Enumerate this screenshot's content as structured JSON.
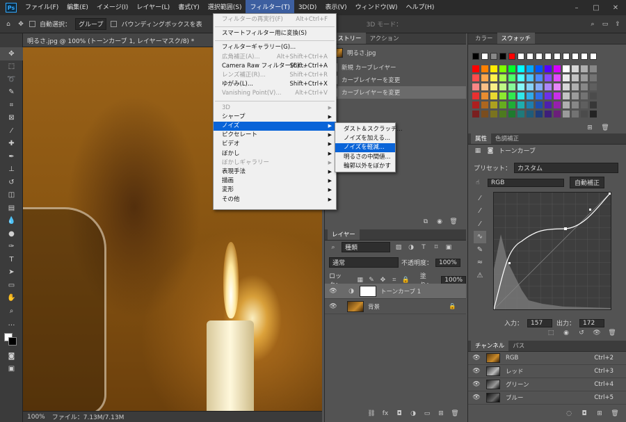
{
  "menubar": {
    "items": [
      "ファイル(F)",
      "編集(E)",
      "イメージ(I)",
      "レイヤー(L)",
      "書式(Y)",
      "選択範囲(S)",
      "フィルター(T)",
      "3D(D)",
      "表示(V)",
      "ウィンドウ(W)",
      "ヘルプ(H)"
    ],
    "active_index": 6
  },
  "options": {
    "auto_select": "自動選択：",
    "group": "グループ",
    "bbox": "バウンディングボックスを表",
    "mode3d": "3D モード："
  },
  "doc": {
    "tab": "明るさ.jpg @ 100% (トーンカーブ 1, レイヤーマスク/8) *",
    "zoom": "100%",
    "file": "ファイル：7.13M/7.13M"
  },
  "filter_menu": [
    {
      "label": "フィルターの再実行(F)",
      "shortcut": "Alt+Ctrl+F",
      "disabled": true
    },
    {
      "sep": true
    },
    {
      "label": "スマートフィルター用に変換(S)",
      "shortcut": ""
    },
    {
      "sep": true
    },
    {
      "label": "フィルターギャラリー(G)...",
      "shortcut": ""
    },
    {
      "label": "広角補正(A)...",
      "shortcut": "Alt+Shift+Ctrl+A",
      "disabled": true
    },
    {
      "label": "Camera Raw フィルター(C)...",
      "shortcut": "Shift+Ctrl+A"
    },
    {
      "label": "レンズ補正(R)...",
      "shortcut": "Shift+Ctrl+R",
      "disabled": true
    },
    {
      "label": "ゆがみ(L)...",
      "shortcut": "Shift+Ctrl+X"
    },
    {
      "label": "Vanishing Point(V)...",
      "shortcut": "Alt+Ctrl+V",
      "disabled": true
    },
    {
      "sep": true
    },
    {
      "label": "3D",
      "sub": true,
      "disabled": true
    },
    {
      "label": "シャープ",
      "sub": true
    },
    {
      "label": "ノイズ",
      "sub": true,
      "highlight": true
    },
    {
      "label": "ピクセレート",
      "sub": true
    },
    {
      "label": "ビデオ",
      "sub": true
    },
    {
      "label": "ぼかし",
      "sub": true
    },
    {
      "label": "ぼかしギャラリー",
      "sub": true,
      "disabled": true
    },
    {
      "label": "表現手法",
      "sub": true
    },
    {
      "label": "描画",
      "sub": true
    },
    {
      "label": "変形",
      "sub": true
    },
    {
      "label": "その他",
      "sub": true
    }
  ],
  "noise_submenu": [
    {
      "label": "ダスト＆スクラッチ..."
    },
    {
      "label": "ノイズを加える..."
    },
    {
      "label": "ノイズを軽減...",
      "highlight": true
    },
    {
      "label": "明るさの中間値..."
    },
    {
      "label": "輪郭以外をぼかす"
    }
  ],
  "history": {
    "tabs": [
      "ヒストリー",
      "アクション"
    ],
    "doc": "明るさ.jpg",
    "items": [
      "新規 カーブレイヤー",
      "カーブレイヤーを変更",
      "カーブレイヤーを変更"
    ],
    "selected": 2
  },
  "layers": {
    "tab": "レイヤー",
    "filter": "種類",
    "blend": "通常",
    "opacity_label": "不透明度：",
    "opacity": "100%",
    "lock_label": "ロック：",
    "fill_label": "塗り：",
    "fill": "100%",
    "items": [
      {
        "name": "トーンカーブ 1"
      },
      {
        "name": "背景"
      }
    ]
  },
  "swatches": {
    "tabs": [
      "カラー",
      "スウォッチ"
    ],
    "colors": [
      "#000",
      "#fff",
      "#888",
      "#000",
      "#ff0000",
      "#fff",
      "#fff",
      "#fff",
      "#fff",
      "#fff",
      "#fff",
      "#fff",
      "#fff",
      "#fff"
    ]
  },
  "properties": {
    "tabs": [
      "属性",
      "色調補正"
    ],
    "title": "トーンカーブ",
    "preset_label": "プリセット：",
    "preset": "カスタム",
    "channel": "RGB",
    "auto": "自動補正",
    "input_label": "入力：",
    "input": "157",
    "output_label": "出力：",
    "output": "172"
  },
  "channels": {
    "tabs": [
      "チャンネル",
      "パス"
    ],
    "items": [
      {
        "name": "RGB",
        "sc": "Ctrl+2"
      },
      {
        "name": "レッド",
        "sc": "Ctrl+3"
      },
      {
        "name": "グリーン",
        "sc": "Ctrl+4"
      },
      {
        "name": "ブルー",
        "sc": "Ctrl+5"
      }
    ]
  },
  "colors": {
    "accent": "#0a64d8"
  }
}
